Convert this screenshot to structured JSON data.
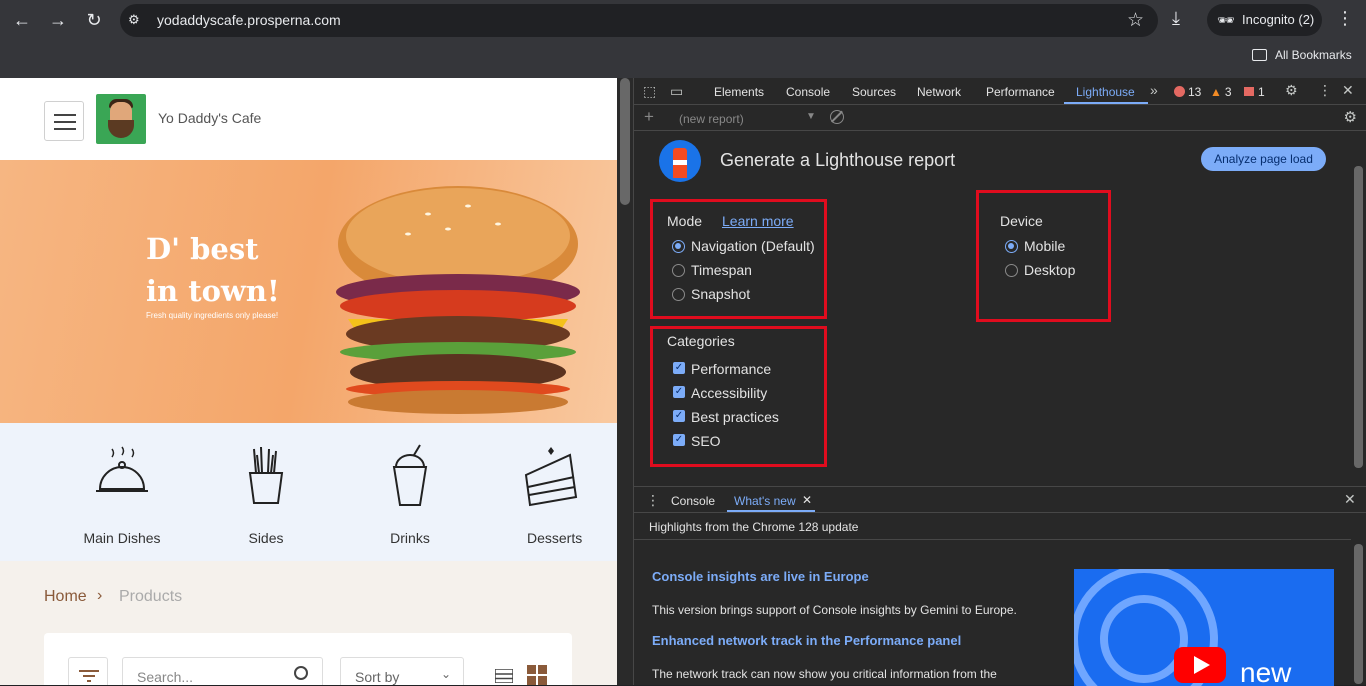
{
  "browser": {
    "url": "yodaddyscafe.prosperna.com",
    "incognito_label": "Incognito (2)",
    "bookmarks_label": "All Bookmarks"
  },
  "site": {
    "brand": "Yo Daddy's Cafe",
    "hero_line1": "D' best",
    "hero_line2": "in town!",
    "hero_sub": "Fresh quality ingredients only please!",
    "categories": [
      "Main Dishes",
      "Sides",
      "Drinks",
      "Desserts"
    ],
    "breadcrumb_home": "Home",
    "breadcrumb_sep": "›",
    "breadcrumb_current": "Products",
    "search_placeholder": "Search...",
    "sort_label": "Sort by"
  },
  "devtools": {
    "tabs": [
      "Elements",
      "Console",
      "Sources",
      "Network",
      "Performance",
      "Lighthouse"
    ],
    "active_tab": "Lighthouse",
    "errors": "13",
    "warnings": "3",
    "issues": "1",
    "report_select": "(new report)"
  },
  "lighthouse": {
    "title": "Generate a Lighthouse report",
    "analyze_button": "Analyze page load",
    "mode_label": "Mode",
    "learn_more": "Learn more",
    "modes": [
      "Navigation (Default)",
      "Timespan",
      "Snapshot"
    ],
    "mode_selected": "Navigation (Default)",
    "device_label": "Device",
    "devices": [
      "Mobile",
      "Desktop"
    ],
    "device_selected": "Mobile",
    "categories_label": "Categories",
    "categories": [
      "Performance",
      "Accessibility",
      "Best practices",
      "SEO"
    ]
  },
  "drawer": {
    "tabs": [
      "Console",
      "What's new"
    ],
    "active_tab": "What's new",
    "highlights": "Highlights from the Chrome 128 update",
    "items": [
      {
        "title": "Console insights are live in Europe",
        "body": "This version brings support of Console insights by Gemini to Europe."
      },
      {
        "title": "Enhanced network track in the Performance panel",
        "body": "The network track can now show you critical information from the"
      }
    ],
    "video_text": "new"
  },
  "colors": {
    "accent": "#7cacf8",
    "highlight_box": "#e00c1e",
    "devtools_bg": "#282828"
  }
}
